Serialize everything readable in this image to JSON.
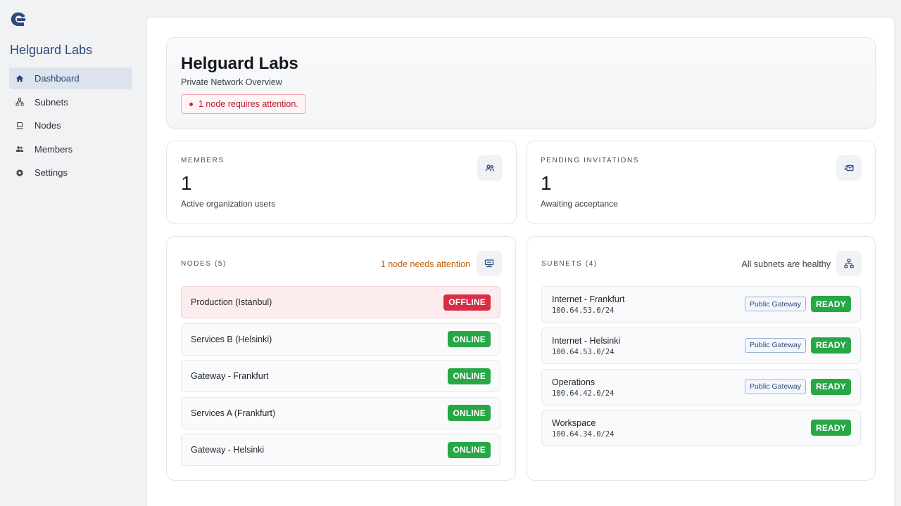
{
  "sidebar": {
    "org_name": "Helguard Labs",
    "items": [
      {
        "label": "Dashboard",
        "icon": "home-icon",
        "active": true
      },
      {
        "label": "Subnets",
        "icon": "network-icon",
        "active": false
      },
      {
        "label": "Nodes",
        "icon": "computer-icon",
        "active": false
      },
      {
        "label": "Members",
        "icon": "users-icon",
        "active": false
      },
      {
        "label": "Settings",
        "icon": "gear-icon",
        "active": false
      }
    ]
  },
  "header": {
    "title": "Helguard Labs",
    "subtitle": "Private Network Overview",
    "alert": "1 node requires attention."
  },
  "stats": {
    "members": {
      "label": "MEMBERS",
      "value": "1",
      "description": "Active organization users",
      "icon": "users-icon"
    },
    "invitations": {
      "label": "PENDING INVITATIONS",
      "value": "1",
      "description": "Awaiting acceptance",
      "icon": "mail-icon"
    }
  },
  "nodes": {
    "label": "NODES (5)",
    "status": "1 node needs attention",
    "icon": "server-icon",
    "items": [
      {
        "name": "Production (Istanbul)",
        "status": "OFFLINE"
      },
      {
        "name": "Services B (Helsinki)",
        "status": "ONLINE"
      },
      {
        "name": "Gateway - Frankfurt",
        "status": "ONLINE"
      },
      {
        "name": "Services A (Frankfurt)",
        "status": "ONLINE"
      },
      {
        "name": "Gateway - Helsinki",
        "status": "ONLINE"
      }
    ]
  },
  "subnets": {
    "label": "SUBNETS (4)",
    "status": "All subnets are healthy",
    "icon": "network-icon",
    "items": [
      {
        "name": "Internet - Frankfurt",
        "cidr": "100.64.53.0/24",
        "tag": "Public Gateway",
        "status": "READY"
      },
      {
        "name": "Internet - Helsinki",
        "cidr": "100.64.53.0/24",
        "tag": "Public Gateway",
        "status": "READY"
      },
      {
        "name": "Operations",
        "cidr": "100.64.42.0/24",
        "tag": "Public Gateway",
        "status": "READY"
      },
      {
        "name": "Workspace",
        "cidr": "100.64.34.0/24",
        "tag": "",
        "status": "READY"
      }
    ]
  },
  "colors": {
    "accent": "#2e4a7d",
    "offline": "#d72e45",
    "online": "#27a745",
    "warning": "#c0600a"
  }
}
